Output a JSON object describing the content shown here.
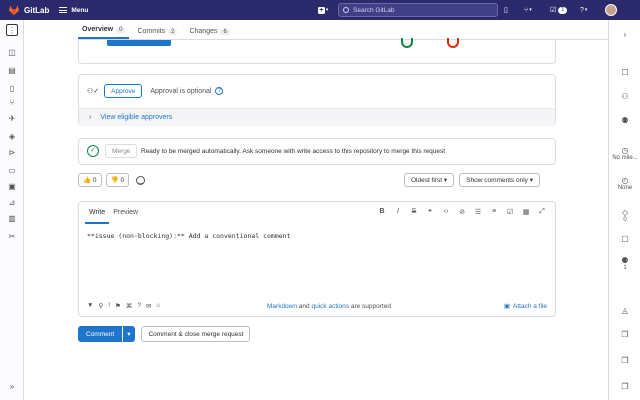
{
  "topbar": {
    "logo_text": "GitLab",
    "menu_label": "Menu",
    "search_placeholder": "Search GitLab",
    "todo_count": "1"
  },
  "tabs": [
    {
      "label": "Overview",
      "count": "0"
    },
    {
      "label": "Commits",
      "count": "2"
    },
    {
      "label": "Changes",
      "count": "6"
    }
  ],
  "approval": {
    "approve_label": "Approve",
    "optional_text": "Approval is optional",
    "eligible_link": "View eligible approvers"
  },
  "merge": {
    "merge_label": "Merge",
    "status_text": "Ready to be merged automatically. Ask someone with write access to this repository to merge this request"
  },
  "reactions": {
    "thumbs_up_count": "0",
    "thumbs_down_count": "0"
  },
  "filters": {
    "sort_label": "Oldest first",
    "show_label": "Show comments only"
  },
  "editor": {
    "write_tab": "Write",
    "preview_tab": "Preview",
    "content": "**issue (non-blocking):** Add a conventional comment",
    "footer_markdown": "Markdown",
    "footer_and": "and",
    "footer_quick": "quick actions",
    "footer_supported": "are supported",
    "attach_label": "Attach a file"
  },
  "actions": {
    "comment_label": "Comment",
    "comment_close_label": "Comment & close merge request"
  },
  "sidebar_right": {
    "milestone": "No mile...",
    "time": "None",
    "labels_count": "0",
    "participants_count": "1"
  },
  "colors": {
    "topbar": "#2b2a6c",
    "primary": "#1f75cb",
    "success": "#108548",
    "danger": "#dd2b0e"
  }
}
